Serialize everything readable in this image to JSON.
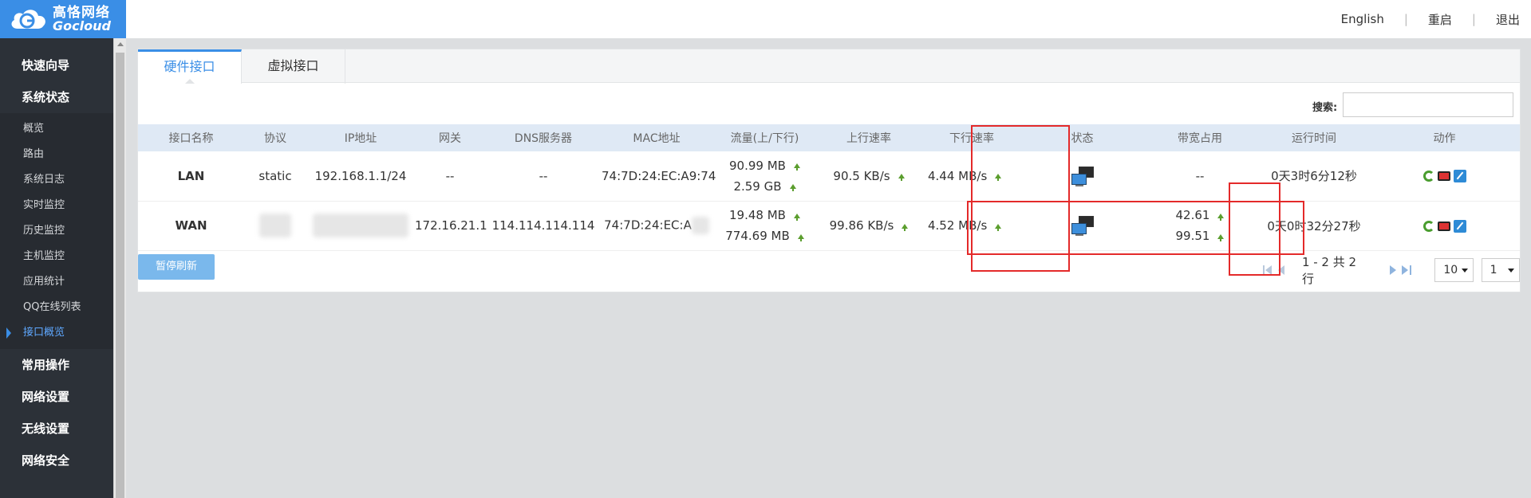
{
  "header": {
    "logo_cn": "高恪网络",
    "logo_en": "Gocloud",
    "nav": [
      "English",
      "重启",
      "退出"
    ]
  },
  "sidebar": {
    "groups_top": [
      "快速向导",
      "系统状态"
    ],
    "subitems": [
      "概览",
      "路由",
      "系统日志",
      "实时监控",
      "历史监控",
      "主机监控",
      "应用统计",
      "QQ在线列表",
      "接口概览"
    ],
    "active_subitem": "接口概览",
    "groups_bottom": [
      "常用操作",
      "网络设置",
      "无线设置",
      "网络安全"
    ]
  },
  "tabs": [
    "硬件接口",
    "虚拟接口"
  ],
  "search": {
    "label": "搜索:",
    "value": ""
  },
  "table": {
    "columns": [
      "接口名称",
      "协议",
      "IP地址",
      "网关",
      "DNS服务器",
      "MAC地址",
      "流量(上/下行)",
      "上行速率",
      "下行速率",
      "状态",
      "带宽占用",
      "运行时间",
      "动作"
    ],
    "rows": [
      {
        "name": "LAN",
        "protocol": "static",
        "ip": "192.168.1.1/24",
        "gateway": "--",
        "dns": "--",
        "mac": "74:7D:24:EC:A9:74",
        "traffic_up": "90.99 MB",
        "traffic_down": "2.59 GB",
        "up_rate": "90.5 KB/s",
        "down_rate": "4.44 MB/s",
        "bandwidth": "--",
        "bandwidth2": "",
        "uptime": "0天3时6分12秒"
      },
      {
        "name": "WAN",
        "protocol": "",
        "ip": "",
        "gateway": "172.16.21.1",
        "dns": "114.114.114.114",
        "mac": "74:7D:24:EC:A",
        "traffic_up": "19.48 MB",
        "traffic_down": "774.69 MB",
        "up_rate": "99.86 KB/s",
        "down_rate": "4.52 MB/s",
        "bandwidth": "42.61",
        "bandwidth2": "99.51",
        "uptime": "0天0时32分27秒"
      }
    ]
  },
  "pause_button": "暂停刷新",
  "pager": {
    "info": "1 - 2 共 2 行",
    "page_size": "10",
    "page": "1"
  },
  "colors": {
    "accent": "#3a8ee6",
    "sidebar": "#2c3138",
    "highlight": "#e42a2a",
    "arrow": "#5b9e2e"
  }
}
